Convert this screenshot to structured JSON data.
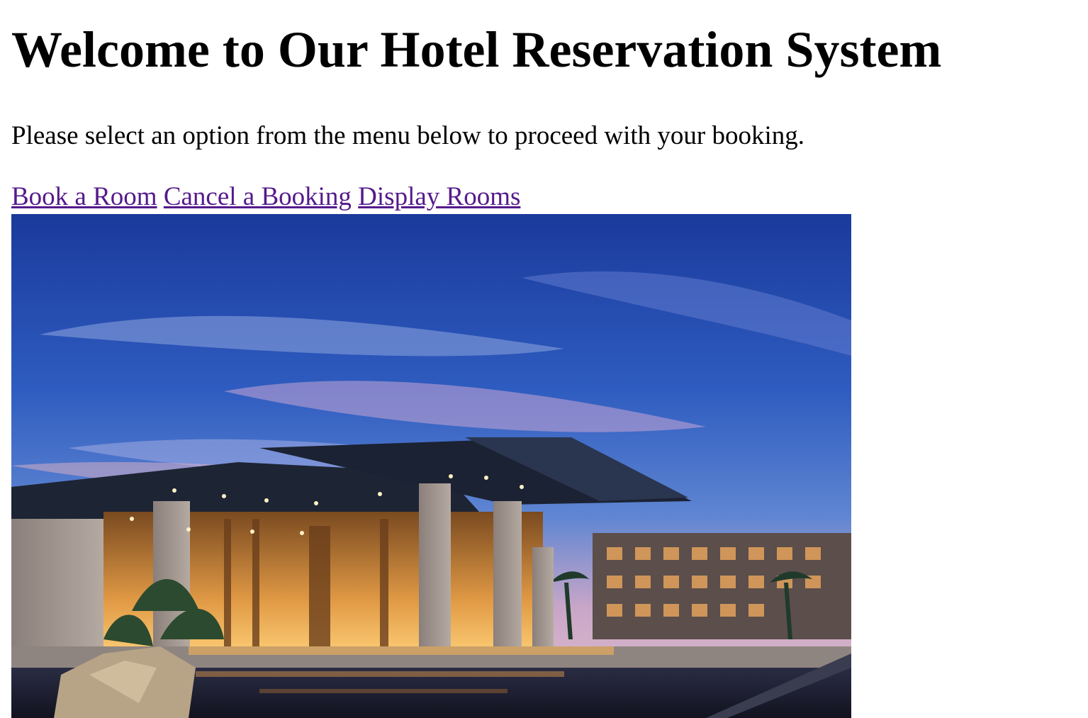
{
  "header": {
    "title": "Welcome to Our Hotel Reservation System"
  },
  "intro": {
    "text": "Please select an option from the menu below to proceed with your booking."
  },
  "nav": {
    "links": [
      {
        "label": "Book a Room"
      },
      {
        "label": "Cancel a Booking"
      },
      {
        "label": "Display Rooms"
      }
    ]
  },
  "colors": {
    "link_visited": "#551a8b",
    "text": "#000000",
    "background": "#ffffff"
  }
}
